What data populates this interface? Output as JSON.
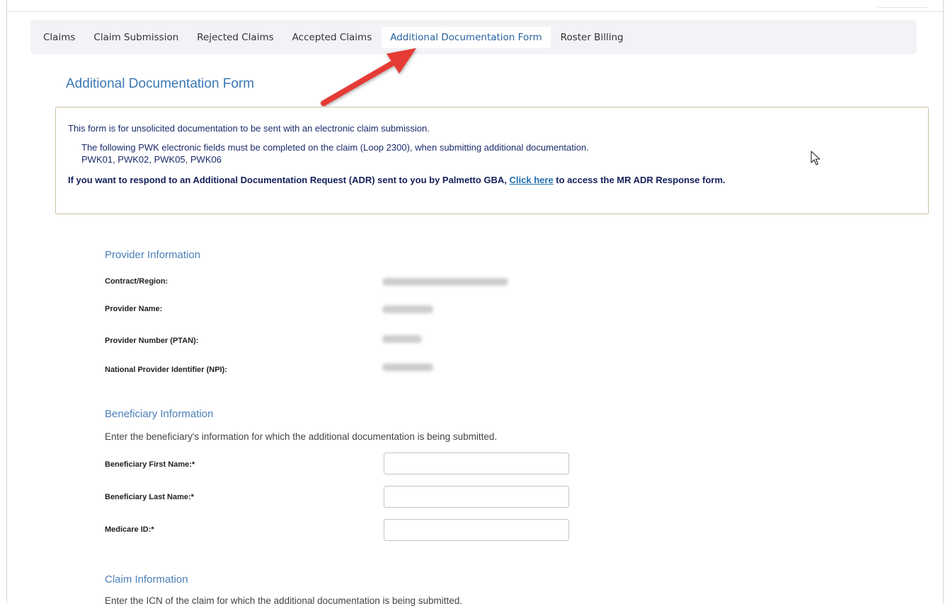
{
  "tabs": [
    {
      "label": "Claims",
      "active": false
    },
    {
      "label": "Claim Submission",
      "active": false
    },
    {
      "label": "Rejected Claims",
      "active": false
    },
    {
      "label": "Accepted Claims",
      "active": false
    },
    {
      "label": "Additional Documentation Form",
      "active": true
    },
    {
      "label": "Roster Billing",
      "active": false
    }
  ],
  "page_title": "Additional Documentation Form",
  "notice": {
    "line1": "This form is for unsolicited documentation to be sent with an electronic claim submission.",
    "line2": "The following PWK electronic fields must be completed on the claim (Loop 2300), when submitting additional documentation.",
    "line3": "PWK01, PWK02, PWK05, PWK06",
    "adr_before": "If you want to respond to an Additional Documentation Request (ADR) sent to you by Palmetto GBA, ",
    "adr_link": "Click here",
    "adr_after": " to access the MR ADR Response form."
  },
  "provider": {
    "title": "Provider Information",
    "fields": [
      {
        "label": "Contract/Region:"
      },
      {
        "label": "Provider Name:"
      },
      {
        "label": "Provider Number (PTAN):"
      },
      {
        "label": "National Provider Identifier (NPI):"
      }
    ]
  },
  "beneficiary": {
    "title": "Beneficiary Information",
    "instructions": "Enter the beneficiary's information for which the additional documentation is being submitted.",
    "fields": [
      {
        "label": "Beneficiary First Name:*",
        "value": ""
      },
      {
        "label": "Beneficiary Last Name:*",
        "value": ""
      },
      {
        "label": "Medicare ID:*",
        "value": ""
      }
    ]
  },
  "claim": {
    "title": "Claim Information",
    "instructions": "Enter the ICN of the claim for which the additional documentation is being submitted."
  },
  "colors": {
    "accent": "#3a78b4",
    "notice_border": "#cfc0a8",
    "arrow": "#e53a36",
    "link": "#1f6fb0"
  }
}
